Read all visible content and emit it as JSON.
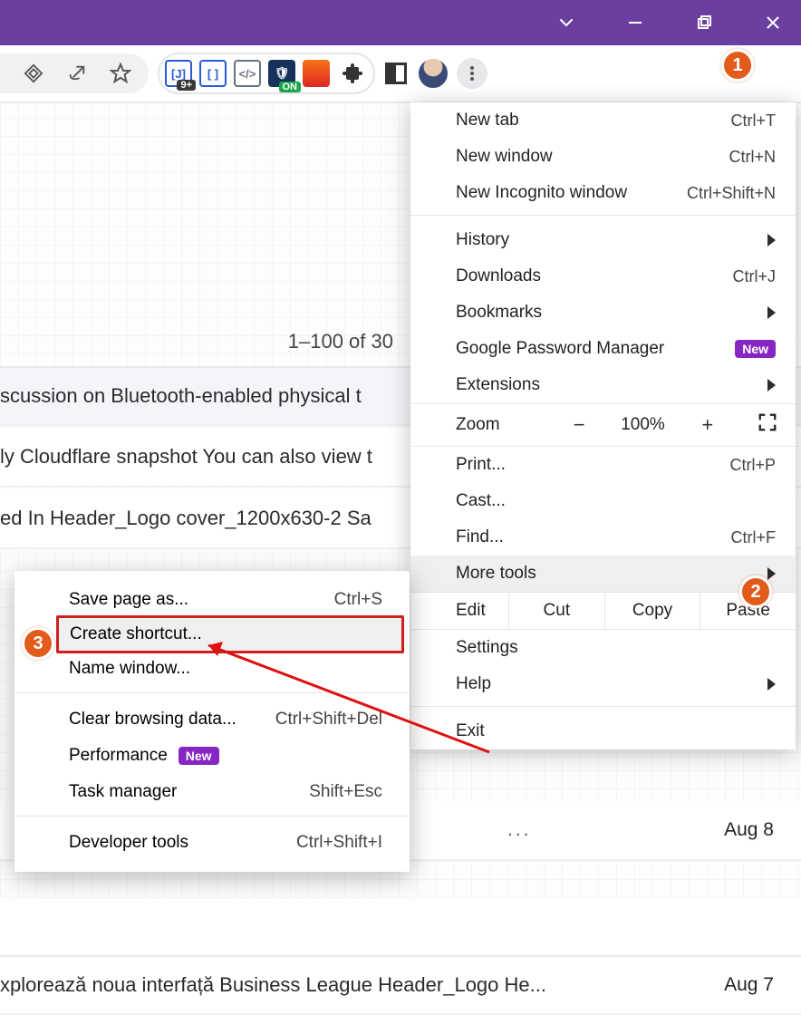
{
  "page": {
    "count_text": "1–100 of 30",
    "rows": {
      "r1": "scussion on Bluetooth-enabled physical t",
      "r2": "ly Cloudflare snapshot You can also view t",
      "r3": "ed In Header_Logo cover_1200x630-2 Sa",
      "r9_text": "xplorează noua interfață Business League Header_Logo He...",
      "r8_date": "Aug 8",
      "r9_date": "Aug 7",
      "ellipsis": "..."
    }
  },
  "main_menu": {
    "new_tab": {
      "label": "New tab",
      "shortcut": "Ctrl+T"
    },
    "new_window": {
      "label": "New window",
      "shortcut": "Ctrl+N"
    },
    "incognito": {
      "label": "New Incognito window",
      "shortcut": "Ctrl+Shift+N"
    },
    "history": {
      "label": "History"
    },
    "downloads": {
      "label": "Downloads",
      "shortcut": "Ctrl+J"
    },
    "bookmarks": {
      "label": "Bookmarks"
    },
    "pwmgr": {
      "label": "Google Password Manager",
      "badge": "New"
    },
    "extensions": {
      "label": "Extensions"
    },
    "zoom_label": "Zoom",
    "zoom_pct": "100%",
    "print": {
      "label": "Print...",
      "shortcut": "Ctrl+P"
    },
    "cast": {
      "label": "Cast..."
    },
    "find": {
      "label": "Find...",
      "shortcut": "Ctrl+F"
    },
    "more_tools": {
      "label": "More tools"
    },
    "edit_lbl": "Edit",
    "cut": "Cut",
    "copy": "Copy",
    "paste": "Paste",
    "settings": {
      "label": "Settings"
    },
    "help": {
      "label": "Help"
    },
    "exit_label": "Exit"
  },
  "submenu": {
    "save_page": {
      "label": "Save page as...",
      "shortcut": "Ctrl+S"
    },
    "create_sc": {
      "label": "Create shortcut..."
    },
    "name_win": {
      "label": "Name window..."
    },
    "clear_data": {
      "label": "Clear browsing data...",
      "shortcut": "Ctrl+Shift+Del"
    },
    "performance": {
      "label": "Performance",
      "badge": "New"
    },
    "task_mgr": {
      "label": "Task manager",
      "shortcut": "Shift+Esc"
    },
    "dev_tools": {
      "label": "Developer tools",
      "shortcut": "Ctrl+Shift+I"
    }
  },
  "markers": {
    "m1": "1",
    "m2": "2",
    "m3": "3"
  },
  "ext_badge_9": "9+",
  "ext_badge_on": "ON"
}
